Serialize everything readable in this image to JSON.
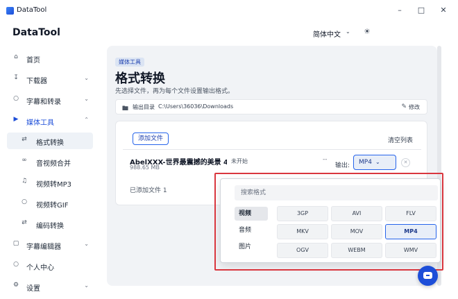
{
  "window": {
    "title": "DataTool",
    "minimize_icon": "minimize-icon",
    "maximize_icon": "maximize-icon",
    "close_icon": "close-icon"
  },
  "header": {
    "brand": "DataTool",
    "language": "简体中文"
  },
  "sidebar": {
    "items": [
      {
        "label": "首页",
        "icon": "home-icon"
      },
      {
        "label": "下载器",
        "icon": "download-icon"
      },
      {
        "label": "字幕和转录",
        "icon": "microphone-icon"
      },
      {
        "label": "媒体工具",
        "icon": "video-icon"
      },
      {
        "label": "格式转换",
        "icon": "swap-icon"
      },
      {
        "label": "音视频合并",
        "icon": "link-icon"
      },
      {
        "label": "视频转MP3",
        "icon": "music-icon"
      },
      {
        "label": "视频转GIF",
        "icon": "gif-icon"
      },
      {
        "label": "编码转换",
        "icon": "swap-icon"
      },
      {
        "label": "字幕编辑器",
        "icon": "subtitle-icon"
      },
      {
        "label": "个人中心",
        "icon": "user-icon"
      },
      {
        "label": "设置",
        "icon": "gear-icon"
      }
    ]
  },
  "main": {
    "badge": "媒体工具",
    "title": "格式转换",
    "subtitle": "先选择文件，再为每个文件设置输出格式。",
    "output_dir": {
      "label": "输出目录",
      "path": "C:\\Users\\36036\\Downloads",
      "edit_label": "修改"
    },
    "card": {
      "add_button": "添加文件",
      "clear_button": "清空列表",
      "file": {
        "name": "AbelXXX-世界最震撼的美景 4...",
        "size": "988.65 MB",
        "status": "未开始",
        "dashes": "--",
        "output_label": "输出:",
        "format": "MP4"
      },
      "added_count": "已添加文件 1"
    }
  },
  "dropdown": {
    "search_placeholder": "搜索格式",
    "categories": [
      "视频",
      "音频",
      "图片"
    ],
    "active_category": "视频",
    "formats": [
      "3GP",
      "AVI",
      "FLV",
      "MKV",
      "MOV",
      "MP4",
      "OGV",
      "WEBM",
      "WMV"
    ],
    "selected_format": "MP4"
  },
  "colors": {
    "accent": "#2563eb",
    "highlight": "#d9363e",
    "main_bg": "#f1f3f6"
  }
}
